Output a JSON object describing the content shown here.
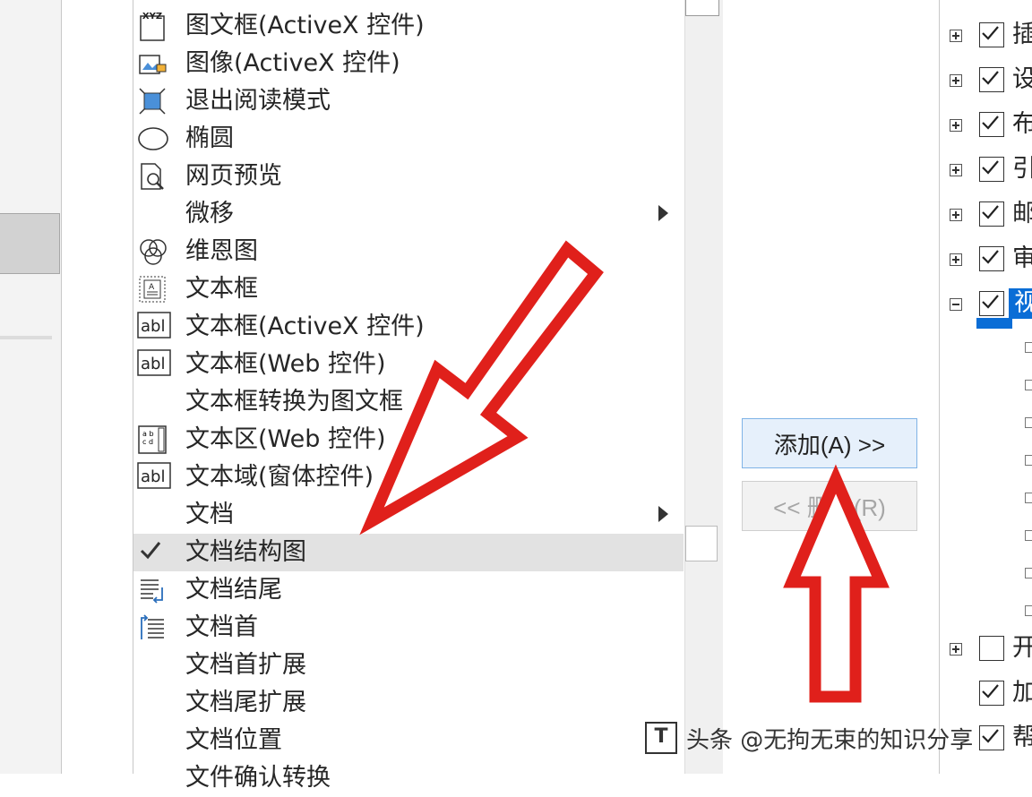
{
  "commands": [
    {
      "label": "图文框(ActiveX 控件)",
      "icon": "xyz-frame-icon",
      "submenu": false,
      "selected": false
    },
    {
      "label": "图像(ActiveX 控件)",
      "icon": "image-control-icon",
      "submenu": false,
      "selected": false
    },
    {
      "label": "退出阅读模式",
      "icon": "exit-reading-icon",
      "submenu": false,
      "selected": false
    },
    {
      "label": "椭圆",
      "icon": "ellipse-icon",
      "submenu": false,
      "selected": false
    },
    {
      "label": "网页预览",
      "icon": "web-preview-icon",
      "submenu": false,
      "selected": false
    },
    {
      "label": "微移",
      "icon": "",
      "submenu": true,
      "selected": false
    },
    {
      "label": "维恩图",
      "icon": "venn-diagram-icon",
      "submenu": false,
      "selected": false
    },
    {
      "label": "文本框",
      "icon": "text-box-icon",
      "submenu": false,
      "selected": false
    },
    {
      "label": "文本框(ActiveX 控件)",
      "icon": "abl-textbox-icon",
      "submenu": false,
      "selected": false
    },
    {
      "label": "文本框(Web 控件)",
      "icon": "abl-textbox-icon",
      "submenu": false,
      "selected": false
    },
    {
      "label": "文本框转换为图文框",
      "icon": "",
      "submenu": false,
      "selected": false
    },
    {
      "label": "文本区(Web 控件)",
      "icon": "text-area-icon",
      "submenu": false,
      "selected": false
    },
    {
      "label": "文本域(窗体控件)",
      "icon": "abl-textbox-icon",
      "submenu": false,
      "selected": false
    },
    {
      "label": "文档",
      "icon": "",
      "submenu": true,
      "selected": false
    },
    {
      "label": "文档结构图",
      "icon": "checkmark-icon",
      "submenu": false,
      "selected": true
    },
    {
      "label": "文档结尾",
      "icon": "document-end-icon",
      "submenu": false,
      "selected": false
    },
    {
      "label": "文档首",
      "icon": "document-start-icon",
      "submenu": false,
      "selected": false
    },
    {
      "label": "文档首扩展",
      "icon": "",
      "submenu": false,
      "selected": false
    },
    {
      "label": "文档尾扩展",
      "icon": "",
      "submenu": false,
      "selected": false
    },
    {
      "label": "文档位置",
      "icon": "",
      "submenu": false,
      "selected": false
    },
    {
      "label": "文件确认转换",
      "icon": "",
      "submenu": false,
      "selected": false
    }
  ],
  "buttons": {
    "add": "添加(A) >>",
    "remove": "<< 删除(R)"
  },
  "tree": [
    {
      "text": "插",
      "expander": "plus",
      "checked": true,
      "selected": false
    },
    {
      "text": "设",
      "expander": "plus",
      "checked": true,
      "selected": false
    },
    {
      "text": "布",
      "expander": "plus",
      "checked": true,
      "selected": false
    },
    {
      "text": "引",
      "expander": "plus",
      "checked": true,
      "selected": false
    },
    {
      "text": "邮",
      "expander": "plus",
      "checked": true,
      "selected": false
    },
    {
      "text": "审",
      "expander": "plus",
      "checked": true,
      "selected": false
    },
    {
      "text": "视",
      "expander": "minus",
      "checked": true,
      "selected": true
    },
    {
      "text": "开",
      "expander": "plus",
      "checked": false,
      "selected": false
    },
    {
      "text": "加",
      "expander": "none",
      "checked": true,
      "selected": false
    },
    {
      "text": "帮",
      "expander": "none",
      "checked": true,
      "selected": false
    }
  ],
  "watermark": {
    "text": "头条 @无拘无束的知识分享"
  },
  "colors": {
    "accent": "#0a6dd6",
    "arrow_red": "#e0201b",
    "selected_row": "#e2e2e2",
    "add_button_bg": "#e6f0fb"
  }
}
